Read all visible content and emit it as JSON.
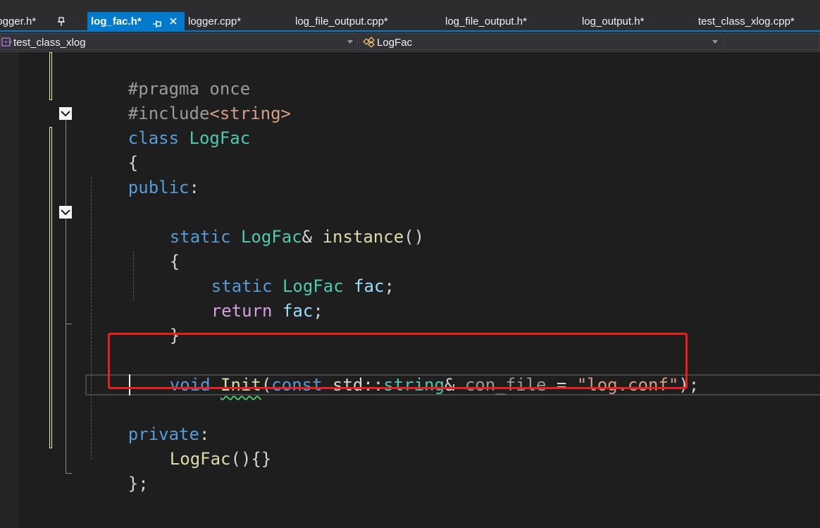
{
  "tabs": [
    {
      "label": "logger.h*"
    },
    {
      "label": "log_fac.h*"
    },
    {
      "label": "logger.cpp*"
    },
    {
      "label": "log_file_output.cpp*"
    },
    {
      "label": "log_file_output.h*"
    },
    {
      "label": "log_output.h*"
    },
    {
      "label": "test_class_xlog.cpp*"
    }
  ],
  "active_tab": "log_fac.h*",
  "tab_pin_glyph": "⊸",
  "tab_close_glyph": "×",
  "navbar": {
    "project": "test_class_xlog",
    "scope": "LogFac"
  },
  "code": {
    "l1": {
      "a": "#pragma once"
    },
    "l2": {
      "a": "#include",
      "b": "<string>"
    },
    "l3": {
      "a": "class",
      "b": " ",
      "c": "LogFac"
    },
    "l4": {
      "a": "{"
    },
    "l5": {
      "a": "public",
      "b": ":"
    },
    "l7": {
      "a": "static",
      "b": " ",
      "c": "LogFac",
      "d": "& ",
      "e": "instance",
      "f": "()"
    },
    "l8": {
      "a": "{"
    },
    "l9": {
      "a": "static",
      "b": " ",
      "c": "LogFac",
      "d": " ",
      "e": "fac",
      "f": ";"
    },
    "l10": {
      "a": "return",
      "b": " ",
      "c": "fac",
      "d": ";"
    },
    "l11": {
      "a": "}"
    },
    "l13": {
      "a": "void",
      "b": " ",
      "c": "Init",
      "d": "(",
      "e": "const",
      "f": " std::",
      "g": "string",
      "h": "& ",
      "i": "con_file",
      "j": " = ",
      "k": "\"log.conf\"",
      "l": ");"
    },
    "l15": {
      "a": "private",
      "b": ":"
    },
    "l16": {
      "a": "LogFac",
      "b": "(){}"
    },
    "l17": {
      "a": "};"
    }
  },
  "colors": {
    "keyword": "#569cd6",
    "control_keyword": "#d8a0df",
    "type": "#4ec9b0",
    "function": "#dcdcaa",
    "variable": "#9cdcfe",
    "string": "#d69d85",
    "highlight_box": "#e8201e",
    "active_tab": "#007acc"
  }
}
